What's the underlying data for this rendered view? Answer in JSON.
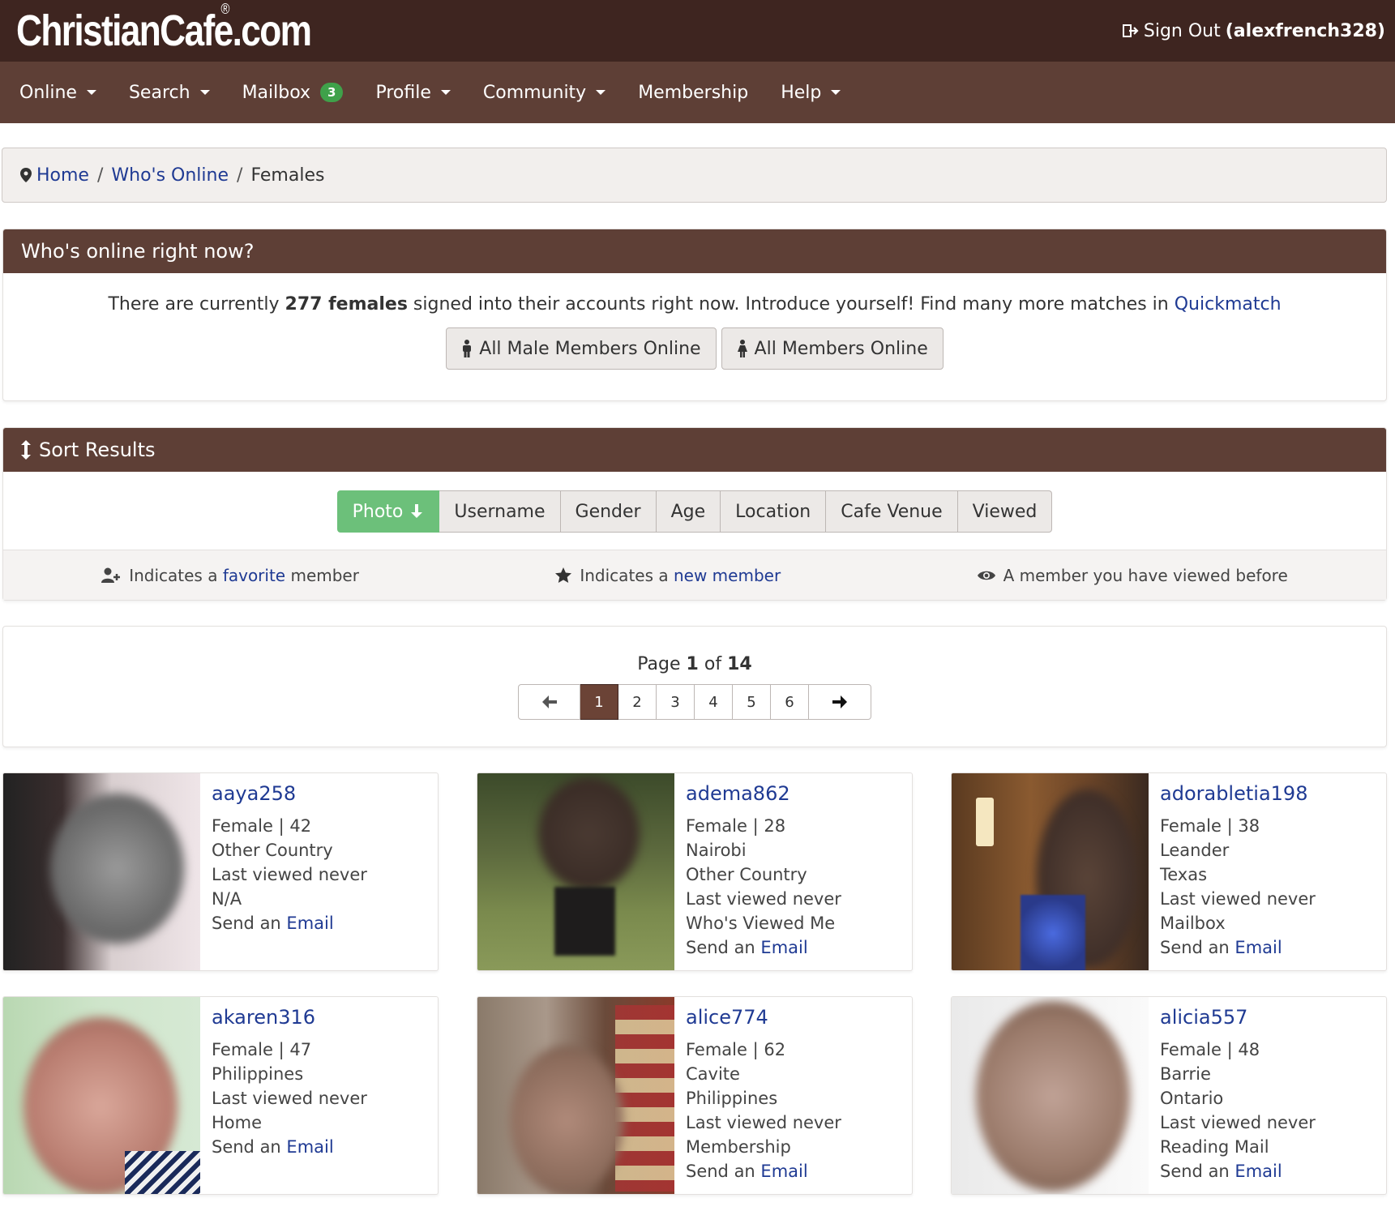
{
  "header": {
    "logo": "ChristianCafe.com",
    "logo_reg": "®",
    "signout_label": "Sign Out",
    "username": "(alexfrench328)"
  },
  "nav": {
    "online": "Online",
    "search": "Search",
    "mailbox": "Mailbox",
    "mailbox_count": "3",
    "profile": "Profile",
    "community": "Community",
    "membership": "Membership",
    "help": "Help"
  },
  "breadcrumb": {
    "home": "Home",
    "sep": "/",
    "whos_online": "Who's Online",
    "current": "Females"
  },
  "online_panel": {
    "title": "Who's online right now?",
    "text_before": "There are currently ",
    "count": "277 females",
    "text_after": " signed into their accounts right now. Introduce yourself! Find many more matches in ",
    "quickmatch": "Quickmatch",
    "btn_male": "All Male Members Online",
    "btn_all": "All Members Online"
  },
  "sort_panel": {
    "title": "Sort Results",
    "options": [
      "Photo",
      "Username",
      "Gender",
      "Age",
      "Location",
      "Cafe Venue",
      "Viewed"
    ],
    "legend_fav_before": "Indicates a ",
    "legend_fav_link": "favorite",
    "legend_fav_after": " member",
    "legend_new_before": "Indicates a ",
    "legend_new_link": "new member",
    "legend_viewed": "A member you have viewed before"
  },
  "pager": {
    "page_word": "Page",
    "current": "1",
    "of_word": "of",
    "total": "14",
    "pages": [
      "1",
      "2",
      "3",
      "4",
      "5",
      "6"
    ]
  },
  "members": [
    {
      "username": "aaya258",
      "lines": [
        "Female | 42",
        "Other Country",
        "Last viewed never",
        "N/A"
      ],
      "send": "Send an ",
      "email": "Email"
    },
    {
      "username": "adema862",
      "lines": [
        "Female | 28",
        "Nairobi",
        "Other Country",
        "Last viewed never",
        "Who's Viewed Me"
      ],
      "send": "Send an ",
      "email": "Email"
    },
    {
      "username": "adorabletia198",
      "lines": [
        "Female | 38",
        "Leander",
        "Texas",
        "Last viewed never",
        "Mailbox"
      ],
      "send": "Send an ",
      "email": "Email"
    },
    {
      "username": "akaren316",
      "lines": [
        "Female | 47",
        "Philippines",
        "Last viewed never",
        "Home"
      ],
      "send": "Send an ",
      "email": "Email"
    },
    {
      "username": "alice774",
      "lines": [
        "Female | 62",
        "Cavite",
        "Philippines",
        "Last viewed never",
        "Membership"
      ],
      "send": "Send an ",
      "email": "Email"
    },
    {
      "username": "alicia557",
      "lines": [
        "Female | 48",
        "Barrie",
        "Ontario",
        "Last viewed never",
        "Reading Mail"
      ],
      "send": "Send an ",
      "email": "Email"
    }
  ],
  "colors": {
    "header_dark": "#3e2520",
    "nav_brown": "#5e3f36",
    "link_blue": "#1f3a93",
    "active_green": "#6cc07a",
    "badge_green": "#3fa14a"
  }
}
